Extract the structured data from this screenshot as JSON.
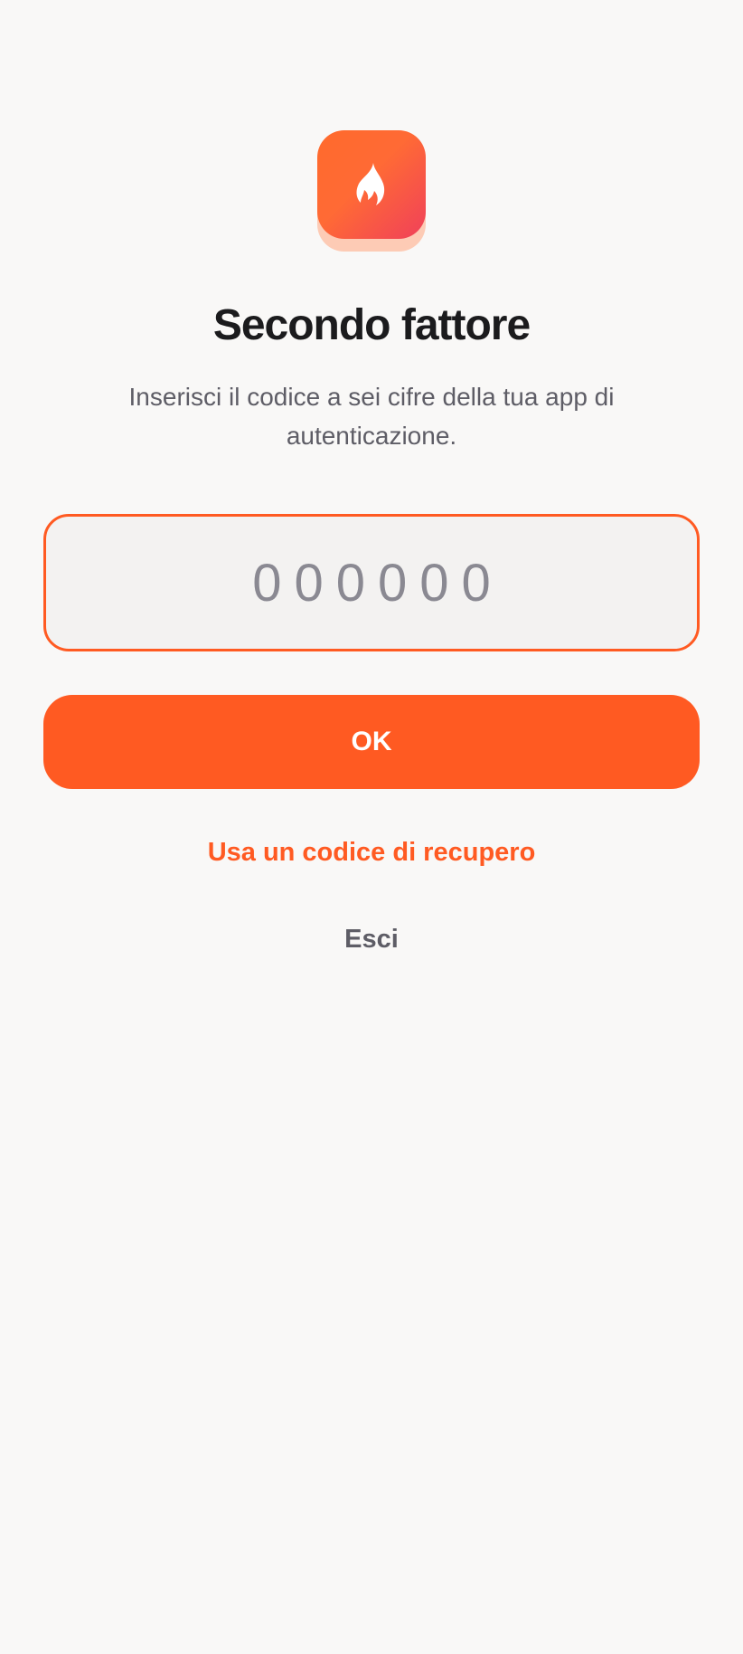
{
  "app": {
    "logo_icon": "flame-icon",
    "accent_color": "#ff5a22"
  },
  "header": {
    "title": "Secondo fattore",
    "subtitle": "Inserisci il codice a sei cifre della tua app di autenticazione."
  },
  "form": {
    "code_value": "",
    "code_placeholder": "000000",
    "submit_label": "OK"
  },
  "links": {
    "recovery_label": "Usa un codice di recupero",
    "exit_label": "Esci"
  }
}
